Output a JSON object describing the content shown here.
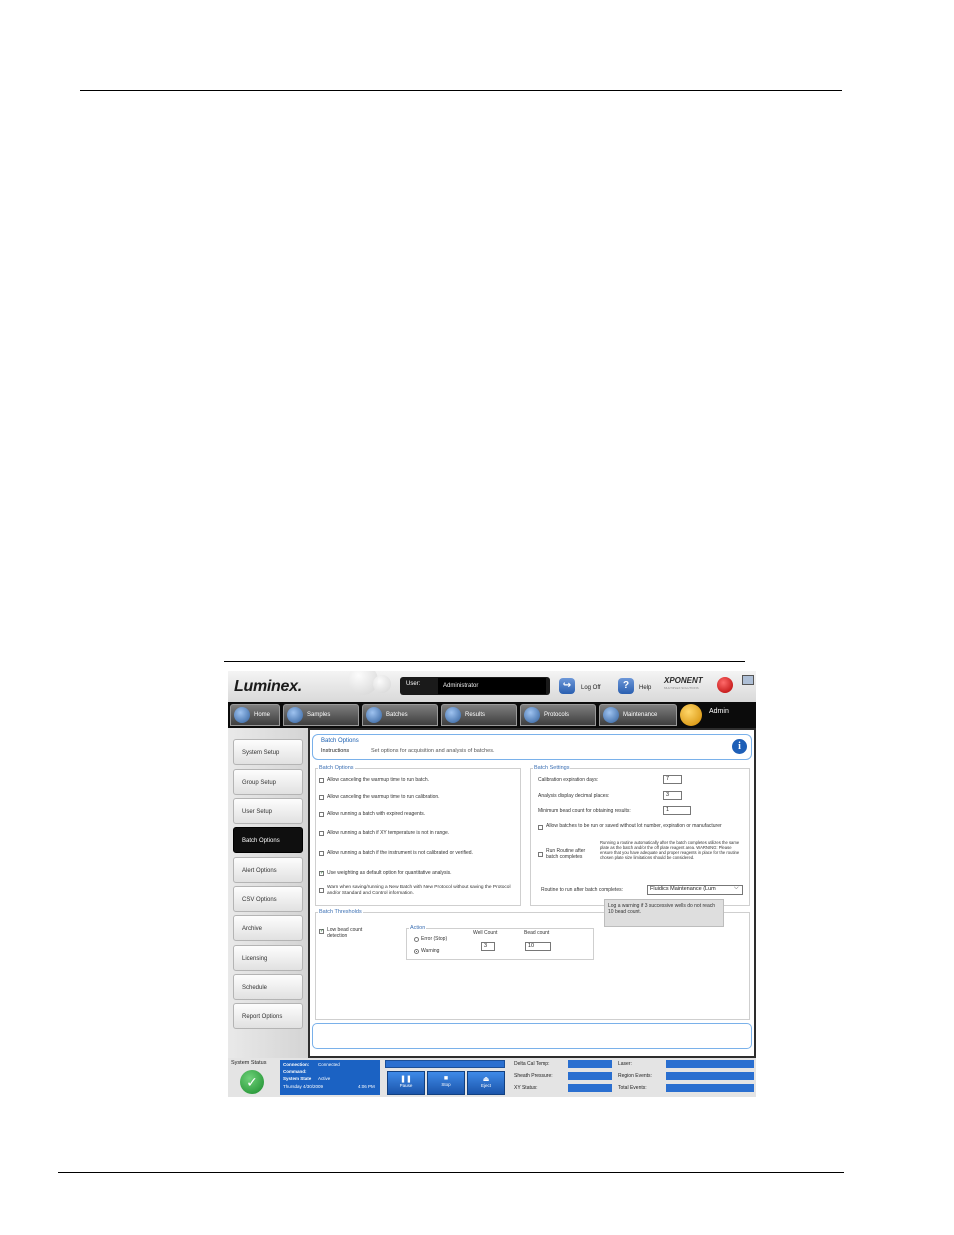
{
  "app": {
    "logo": "Luminex.",
    "user_label": "User:",
    "user_value": "Administrator",
    "logoff_label": "Log Off",
    "help_label": "Help",
    "brand": "XPONENT",
    "brand_sub": "MULTIPLEX SOLUTIONS"
  },
  "nav": {
    "tabs": [
      {
        "label": "Home"
      },
      {
        "label": "Samples"
      },
      {
        "label": "Batches"
      },
      {
        "label": "Results"
      },
      {
        "label": "Protocols"
      },
      {
        "label": "Maintenance"
      }
    ],
    "active_tab": "Admin"
  },
  "sidebar": {
    "items": [
      {
        "label": "System Setup"
      },
      {
        "label": "Group Setup"
      },
      {
        "label": "User Setup"
      },
      {
        "label": "Batch Options"
      },
      {
        "label": "Alert Options"
      },
      {
        "label": "CSV Options"
      },
      {
        "label": "Archive"
      },
      {
        "label": "Licensing"
      },
      {
        "label": "Schedule"
      },
      {
        "label": "Report Options"
      }
    ],
    "active": "Batch Options"
  },
  "instructions": {
    "title": "Batch Options",
    "heading": "Instructions",
    "text": "Set options for acquisition and analysis of batches."
  },
  "batch_options": {
    "title": "Batch Options",
    "items": [
      {
        "label": "Allow canceling the warmup time to run batch.",
        "checked": false
      },
      {
        "label": "Allow canceling the warmup time to run calibration.",
        "checked": false
      },
      {
        "label": "Allow running a batch with expired reagents.",
        "checked": false
      },
      {
        "label": "Allow running a batch if XY temperature is not in range.",
        "checked": false
      },
      {
        "label": "Allow running a batch if the instrument is not calibrated or verified.",
        "checked": false
      },
      {
        "label": "Use weighting as default option for quantitative analysis.",
        "checked": true
      },
      {
        "label": "Warn when saving/running a New Batch with New Protocol without saving the Protocol and/or Standard and Control information.",
        "checked": false
      }
    ]
  },
  "batch_settings": {
    "title": "Batch Settings",
    "calibration_label": "Calibration expiration days:",
    "calibration_value": "7",
    "decimal_label": "Analysis display decimal places:",
    "decimal_value": "3",
    "min_bead_label": "Minimum bead count for obtaining results:",
    "min_bead_value": "1",
    "allow_batches_label": "Allow batches to be run or saved without lot number, expiration or manufacturer",
    "run_routine_label": "Run Routine after batch completes",
    "run_routine_note": "Running a routine automatically after the batch completes utilizes the same plate as the batch and/or the off plate reagent area. WARNING: Please ensure that you have adequate and proper reagents in place for the routine chosen plate size limitations should be considered.",
    "routine_label": "Routine to run after batch completes:",
    "routine_value": "Fluidics Maintenance (Lum"
  },
  "thresholds": {
    "title": "Batch Thresholds",
    "low_bead_label": "Low bead count detection",
    "low_bead_checked": true,
    "action_title": "Action",
    "error_label": "Error (Stop)",
    "warning_label": "Warning",
    "selected_action": "Warning",
    "well_count_label": "Well Count",
    "well_count_value": "3",
    "bead_count_label": "Bead count",
    "bead_count_value": "10",
    "note": "Log a warning if 3 successive wells do not reach 10 bead count."
  },
  "status": {
    "system_status_label": "System Status",
    "connection_label": "Connection:",
    "connection_value": "Connected",
    "command_label": "Command:",
    "system_state_label": "System State",
    "system_state_value": "Active",
    "date_value": "Thursday 4/30/2009",
    "time_value": "4:06 PM",
    "pause_label": "Pause",
    "stop_label": "Stop",
    "eject_label": "Eject",
    "delta_cal_label": "Delta Cal Temp:",
    "sheath_label": "Sheath Pressure:",
    "xy_label": "XY Status:",
    "laser_label": "Laser:",
    "region_label": "Region Events:",
    "total_label": "Total Events:"
  },
  "colors": {
    "accent_blue": "#1e5fb7",
    "group_title_blue": "#3b6fb3",
    "status_green": "#188a2a"
  }
}
